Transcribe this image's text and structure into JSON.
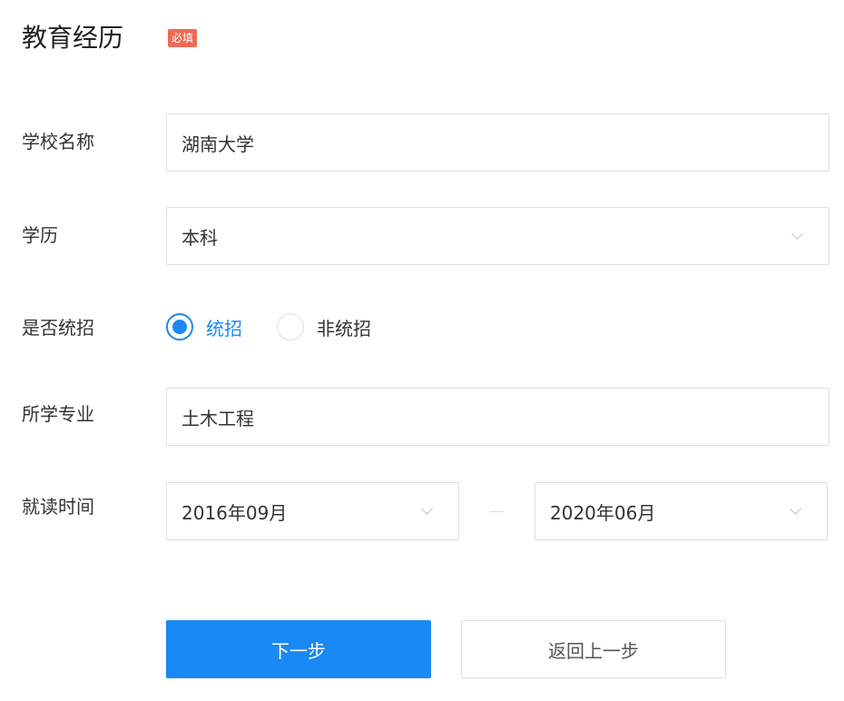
{
  "section": {
    "title": "教育经历",
    "required_badge": "必填"
  },
  "form": {
    "school": {
      "label": "学校名称",
      "value": "湖南大学"
    },
    "degree": {
      "label": "学历",
      "value": "本科"
    },
    "enrollment": {
      "label": "是否统招",
      "options": [
        {
          "label": "统招",
          "checked": true
        },
        {
          "label": "非统招",
          "checked": false
        }
      ]
    },
    "major": {
      "label": "所学专业",
      "value": "土木工程"
    },
    "period": {
      "label": "就读时间",
      "start": "2016年09月",
      "end": "2020年06月"
    }
  },
  "actions": {
    "next_label": "下一步",
    "back_label": "返回上一步"
  },
  "colors": {
    "primary": "#1a89f4",
    "badge": "#ee6b55",
    "border": "#dcdfe6"
  }
}
